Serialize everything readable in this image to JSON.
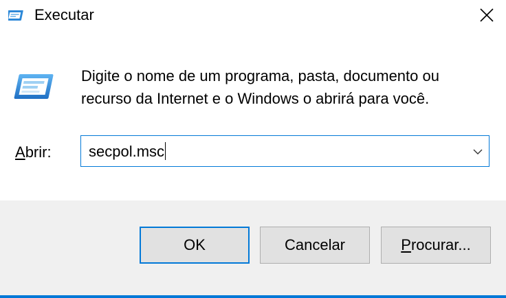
{
  "window": {
    "title": "Executar",
    "close_glyph": "close-icon"
  },
  "body": {
    "description": "Digite o nome de um programa, pasta, documento ou recurso da Internet e o Windows o abrirá para você.",
    "open_label_accel": "A",
    "open_label_rest": "brir:",
    "input_value": "secpol.msc",
    "icons": [
      "run-icon",
      "chevron-down-icon"
    ]
  },
  "buttons": {
    "ok": "OK",
    "cancel": "Cancelar",
    "browse_accel": "P",
    "browse_rest": "rocurar..."
  },
  "colors": {
    "accent": "#0078d7",
    "footer_bg": "#f0f0f0",
    "button_bg": "#e1e1e1",
    "button_border": "#adadad"
  }
}
